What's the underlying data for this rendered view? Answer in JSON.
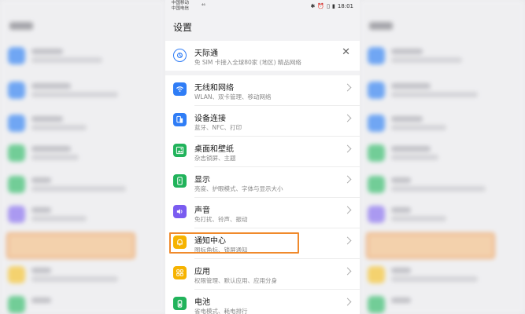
{
  "status_bar": {
    "carrier1": "中国移动",
    "carrier2": "中国电信",
    "network": "⁴⁶",
    "time": "18:01"
  },
  "page_title": "设置",
  "banner": {
    "title": "天际通",
    "subtitle": "免 SIM 卡接入全球80家 (地区) 精品网络",
    "icon": "tianjitong-icon",
    "color": "#2f7df6"
  },
  "items": [
    {
      "key": "wireless",
      "title": "无线和网络",
      "subtitle": "WLAN、双卡管理、移动网络",
      "icon": "wifi-icon",
      "color": "#2f7df6"
    },
    {
      "key": "devices",
      "title": "设备连接",
      "subtitle": "蓝牙、NFC、打印",
      "icon": "device-connect-icon",
      "color": "#2f7df6"
    },
    {
      "key": "wallpaper",
      "title": "桌面和壁纸",
      "subtitle": "杂志锁屏、主题",
      "icon": "wallpaper-icon",
      "color": "#21b35b"
    },
    {
      "key": "display",
      "title": "显示",
      "subtitle": "亮度、护眼模式、字体与显示大小",
      "icon": "display-icon",
      "color": "#21b35b"
    },
    {
      "key": "sound",
      "title": "声音",
      "subtitle": "免打扰、铃声、振动",
      "icon": "sound-icon",
      "color": "#7a5cf0"
    },
    {
      "key": "notification",
      "title": "通知中心",
      "subtitle": "图标角标、锁屏通知",
      "icon": "bell-icon",
      "color": "#f6b300"
    },
    {
      "key": "apps",
      "title": "应用",
      "subtitle": "权限管理、默认应用、应用分身",
      "icon": "apps-icon",
      "color": "#f6b300"
    },
    {
      "key": "battery",
      "title": "电池",
      "subtitle": "省电模式、耗电排行",
      "icon": "battery-icon",
      "color": "#21b35b"
    }
  ],
  "highlight_color": "#f08a2c"
}
